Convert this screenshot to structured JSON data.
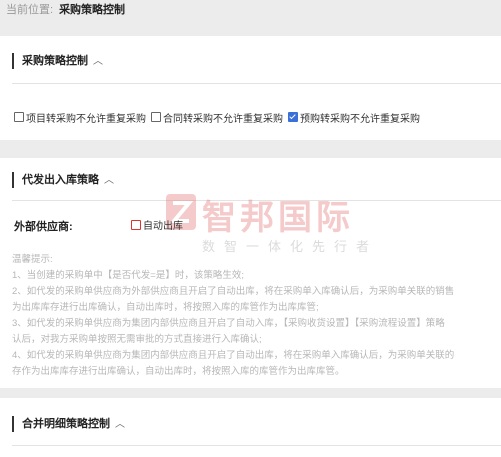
{
  "breadcrumb": {
    "prefix": "当前位置:",
    "current": "采购策略控制"
  },
  "section1": {
    "title": "采购策略控制",
    "checkboxes": [
      {
        "label": "项目转采购不允许重复采购",
        "checked": false
      },
      {
        "label": "合同转采购不允许重复采购",
        "checked": false
      },
      {
        "label": "预购转采购不允许重复采购",
        "checked": true
      }
    ]
  },
  "section2": {
    "title": "代发出入库策略",
    "vendor_label": "外部供应商:",
    "auto_label": "自动出库",
    "auto_checked": false,
    "hint_title": "温馨提示:",
    "hints": [
      "1、当创建的采购单中【是否代发=是】时，该策略生效;",
      "2、如代发的采购单供应商为外部供应商且开启了自动出库，将在采购单入库确认后，为采购单关联的销售",
      "为出库库存进行出库确认，自动出库时，将按照入库的库管作为出库库管;",
      "3、如代发的采购单供应商为集团内部供应商且开启了自动入库，【采购收货设置】【采购流程设置】策略",
      "认后，对我方采购单按照无需审批的方式直接进行入库确认;",
      "4、如代发的采购单供应商为集团内部供应商且开启了自动出库，将在采购单入库确认后，为采购单关联的",
      "存作为出库库存进行出库确认，自动出库时，将按照入库的库管作为出库库管。"
    ]
  },
  "section3": {
    "title": "合并明细策略控制"
  },
  "watermark": {
    "name": "智邦国际",
    "slogan": "数智一体化先行者"
  },
  "icons": {
    "chevron": "chevron-up-icon"
  },
  "colors": {
    "accent": "#3a70d8",
    "watermark": "#e26a6a"
  }
}
